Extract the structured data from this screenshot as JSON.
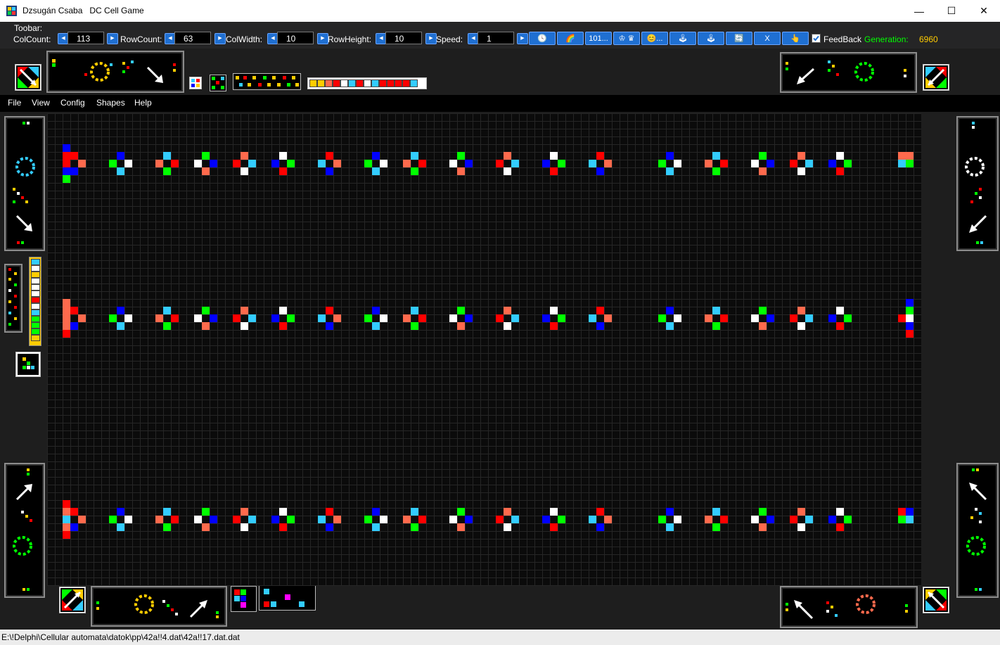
{
  "window": {
    "title": "Dzsugán Csaba   DC Cell Game",
    "minimize_glyph": "—",
    "maximize_glyph": "☐",
    "close_glyph": "✕"
  },
  "toolbar": {
    "caption": "Toobar:",
    "colcount_label": "ColCount:",
    "colcount_value": "113",
    "rowcount_label": "RowCount:",
    "rowcount_value": "63",
    "colwidth_label": "ColWidth:",
    "colwidth_value": "10",
    "rowheight_label": "RowHeight:",
    "rowheight_value": "10",
    "speed_label": "Speed:",
    "speed_value": "1",
    "buttons": [
      {
        "icon": "clock-icon",
        "glyph": "🕓"
      },
      {
        "icon": "rainbow-icon",
        "glyph": "🌈"
      },
      {
        "icon": "binary-icon",
        "glyph": "101..."
      },
      {
        "icon": "chess-icon",
        "glyph": "♔ ♛"
      },
      {
        "icon": "emoji-icon",
        "glyph": "😊..."
      },
      {
        "icon": "gamepad-icon",
        "glyph": "🕹"
      },
      {
        "icon": "gamepad-icon",
        "glyph": "🕹"
      },
      {
        "icon": "refresh-icon",
        "glyph": "🔄"
      },
      {
        "icon": "excel-icon",
        "glyph": "X"
      },
      {
        "icon": "hand-pointer-icon",
        "glyph": "👆"
      }
    ],
    "feedback_label": "FeedBack",
    "feedback_checked": true,
    "generation_label": "Generation:",
    "generation_value": "6960"
  },
  "menu": [
    "File",
    "View",
    "Config",
    "Shapes",
    "Help"
  ],
  "status": {
    "path": "E:\\!Delphi\\Cellular automata\\datok\\pp\\42a!!4.dat\\42a!!17.dat.dat"
  },
  "colors": {
    "red": "#ff0000",
    "blue": "#0000ff",
    "green": "#00ff00",
    "cyan": "#33ccff",
    "white": "#ffffff",
    "salmon": "#ff6a4d",
    "yellow": "#ffcc00",
    "magenta": "#ff00ff",
    "generation_label": "#00ff00",
    "generation_value": "#ffcc00"
  },
  "board": {
    "pattern_rows": [
      {
        "row": 6,
        "cols": [
          3,
          9,
          15,
          20,
          25,
          30,
          36,
          42,
          47,
          53,
          59,
          65,
          71,
          80,
          86,
          92,
          97,
          102
        ]
      },
      {
        "row": 26,
        "cols": [
          3,
          9,
          15,
          20,
          25,
          30,
          36,
          42,
          47,
          53,
          59,
          65,
          71,
          80,
          86,
          92,
          97,
          102
        ]
      },
      {
        "row": 52,
        "cols": [
          3,
          9,
          15,
          20,
          25,
          30,
          36,
          42,
          47,
          53,
          59,
          65,
          71,
          80,
          86,
          92,
          97,
          102
        ]
      }
    ],
    "edge_cells_left": [
      {
        "col": 2,
        "row": 4,
        "color": "blue"
      },
      {
        "col": 2,
        "row": 5,
        "color": "red"
      },
      {
        "col": 2,
        "row": 6,
        "color": "red"
      },
      {
        "col": 2,
        "row": 7,
        "color": "blue"
      },
      {
        "col": 2,
        "row": 8,
        "color": "green"
      },
      {
        "col": 2,
        "row": 24,
        "color": "salmon"
      },
      {
        "col": 2,
        "row": 25,
        "color": "salmon"
      },
      {
        "col": 2,
        "row": 26,
        "color": "salmon"
      },
      {
        "col": 2,
        "row": 27,
        "color": "salmon"
      },
      {
        "col": 2,
        "row": 28,
        "color": "red"
      },
      {
        "col": 2,
        "row": 50,
        "color": "red"
      },
      {
        "col": 2,
        "row": 51,
        "color": "salmon"
      },
      {
        "col": 2,
        "row": 52,
        "color": "cyan"
      },
      {
        "col": 2,
        "row": 53,
        "color": "salmon"
      },
      {
        "col": 2,
        "row": 54,
        "color": "red"
      }
    ],
    "edge_cells_right": [
      {
        "col": 110,
        "row": 5,
        "color": "salmon"
      },
      {
        "col": 111,
        "row": 5,
        "color": "salmon"
      },
      {
        "col": 110,
        "row": 6,
        "color": "cyan"
      },
      {
        "col": 111,
        "row": 6,
        "color": "green"
      },
      {
        "col": 111,
        "row": 24,
        "color": "blue"
      },
      {
        "col": 111,
        "row": 25,
        "color": "green"
      },
      {
        "col": 110,
        "row": 26,
        "color": "red"
      },
      {
        "col": 111,
        "row": 26,
        "color": "white"
      },
      {
        "col": 111,
        "row": 27,
        "color": "blue"
      },
      {
        "col": 111,
        "row": 28,
        "color": "red"
      },
      {
        "col": 110,
        "row": 51,
        "color": "red"
      },
      {
        "col": 111,
        "row": 51,
        "color": "blue"
      },
      {
        "col": 110,
        "row": 52,
        "color": "green"
      },
      {
        "col": 111,
        "row": 52,
        "color": "cyan"
      }
    ]
  },
  "palettes": {
    "strip_top": [
      "yellow",
      "yellow",
      "salmon",
      "red",
      "white",
      "cyan",
      "red",
      "white",
      "cyan",
      "red",
      "red",
      "red",
      "red",
      "cyan"
    ],
    "strip_side": [
      "cyan",
      "white",
      "yellow",
      "white",
      "white",
      "white",
      "red",
      "white",
      "cyan",
      "green",
      "green",
      "green",
      "yellow"
    ]
  }
}
